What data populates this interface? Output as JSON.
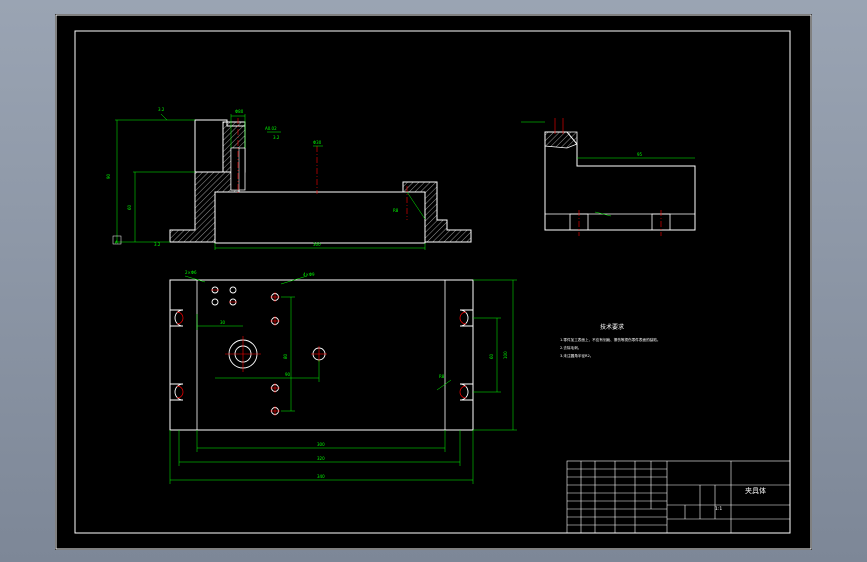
{
  "drawing": {
    "technical_requirements": {
      "title": "技术要求",
      "items": [
        "1.零件加工表面上，不应有划痕、擦伤等损伤零件表面的缺陷。",
        "2.去除毛刺。",
        "3.未注圆角半径R2。"
      ]
    },
    "title_block": {
      "part_name": "夹具体",
      "scale": "1:1"
    }
  },
  "colors": {
    "background": "#000000",
    "outline": "#ffffff",
    "dimension": "#00ff00",
    "centerline": "#ff0000",
    "hatch": "#ffffff",
    "sheet_frame": "#ffffff"
  }
}
